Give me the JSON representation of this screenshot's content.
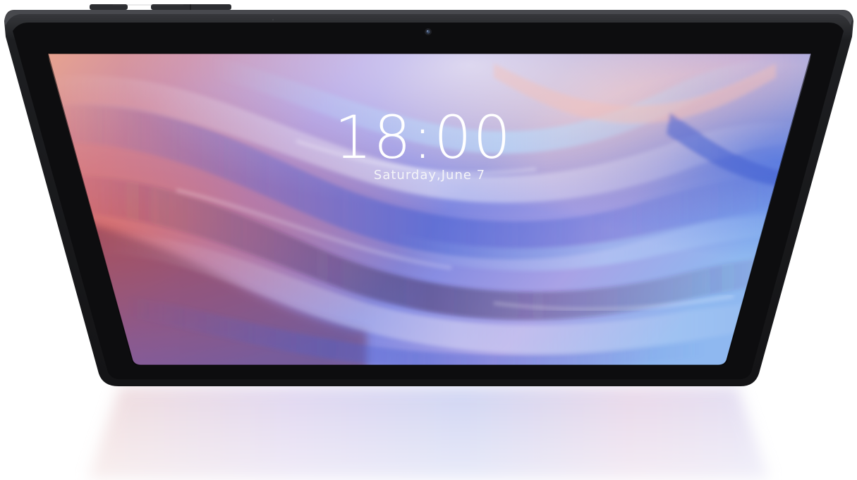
{
  "lock_screen": {
    "time": "18:00",
    "date": "Saturday,June 7"
  },
  "device": {
    "type": "tablet",
    "bezel_color": "#141416",
    "frame_color": "#2a2b2e"
  },
  "wallpaper": {
    "style": "abstract flowing silk waves",
    "colors": [
      "#e9a58f",
      "#b88ad6",
      "#6f7fd6",
      "#9fc6f2",
      "#5a3e7a",
      "#d86a5a"
    ]
  },
  "icons": [
    "front-camera-icon",
    "volume-button-icon",
    "power-button-icon"
  ]
}
